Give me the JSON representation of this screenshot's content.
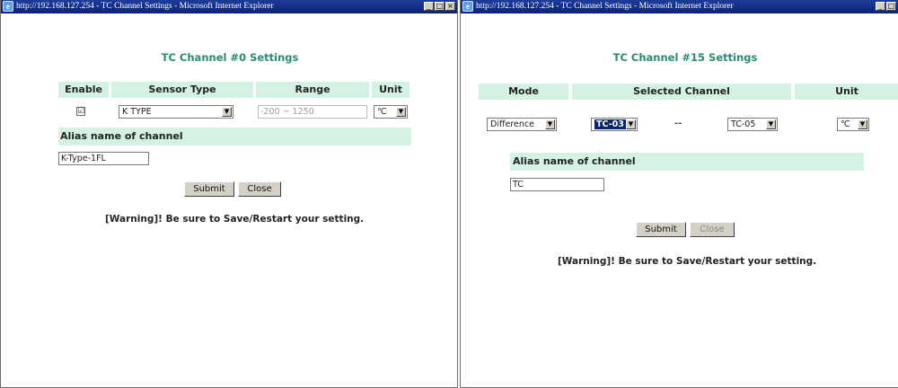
{
  "left_window": {
    "title": "http://192.168.127.254 - TC Channel Settings - Microsoft Internet Explorer",
    "controls": [
      "_",
      "□",
      "×"
    ],
    "heading": "TC Channel #0 Settings",
    "columns": [
      "Enable",
      "Sensor Type",
      "Range",
      "Unit"
    ],
    "row": {
      "enabled": true,
      "enable_mark": "☑",
      "sensor_type": "K TYPE",
      "range": "-200 ~ 1250",
      "unit": "℃"
    },
    "alias_label": "Alias name of  channel",
    "alias_value": "K-Type-1FL",
    "submit_label": "Submit",
    "close_label": "Close",
    "warning": "[Warning]! Be sure to Save/Restart your setting."
  },
  "right_window": {
    "title": "http://192.168.127.254 - TC Channel Settings - Microsoft Internet Explorer",
    "controls": [
      "_",
      "□"
    ],
    "heading": "TC Channel #15 Settings",
    "columns": [
      "Mode",
      "Selected Channel",
      "Unit"
    ],
    "row": {
      "mode": "Difference",
      "channel_a": "TC-03",
      "separator": "--",
      "channel_b": "TC-05",
      "unit": "℃"
    },
    "alias_label": "Alias name of channel",
    "alias_value": "TC",
    "submit_label": "Submit",
    "close_label": "Close",
    "warning": "[Warning]! Be sure to Save/Restart your setting."
  },
  "icons": {
    "dropdown_arrow": "▼",
    "ie_icon": "e"
  },
  "colors": {
    "titlebar": "#0c2477",
    "heading_text": "#2a8a74",
    "header_fill": "#d4f2e4",
    "selection": "#0a246a",
    "button_face": "#d4d0c8"
  }
}
